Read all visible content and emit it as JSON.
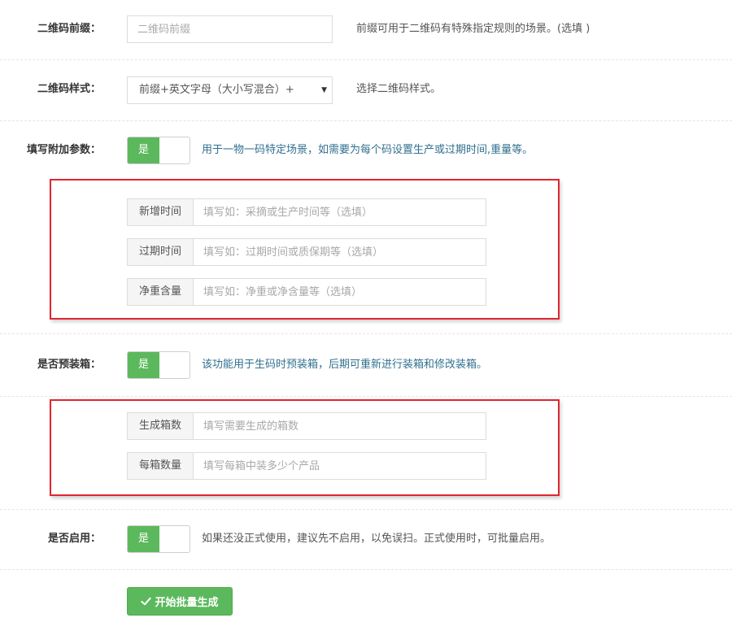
{
  "prefix": {
    "label": "二维码前缀：",
    "placeholder": "二维码前缀",
    "hint": "前缀可用于二维码有特殊指定规则的场景。(选填 )"
  },
  "style": {
    "label": "二维码样式：",
    "selected": "前缀+英文字母（大小写混合）+",
    "hint": "选择二维码样式。"
  },
  "extra_params": {
    "label": "填写附加参数：",
    "toggle_on": "是",
    "hint": "用于一物一码特定场景，如需要为每个码设置生产或过期时间,重量等。",
    "fields": [
      {
        "addon": "新增时间",
        "placeholder": "填写如：采摘或生产时间等（选填）"
      },
      {
        "addon": "过期时间",
        "placeholder": "填写如：过期时间或质保期等（选填）"
      },
      {
        "addon": "净重含量",
        "placeholder": "填写如：净重或净含量等（选填）"
      }
    ]
  },
  "prepack": {
    "label": "是否预装箱：",
    "toggle_on": "是",
    "hint": "该功能用于生码时预装箱，后期可重新进行装箱和修改装箱。",
    "fields": [
      {
        "addon": "生成箱数",
        "placeholder": "填写需要生成的箱数"
      },
      {
        "addon": "每箱数量",
        "placeholder": "填写每箱中装多少个产品"
      }
    ]
  },
  "enable": {
    "label": "是否启用：",
    "toggle_on": "是",
    "hint": "如果还没正式使用，建议先不启用，以免误扫。正式使用时，可批量启用。"
  },
  "submit": {
    "label": "开始批量生成",
    "icon": "check-icon"
  },
  "colors": {
    "green": "#5cb85c",
    "red_highlight": "#e0262f",
    "hint_teal": "#31708f"
  }
}
